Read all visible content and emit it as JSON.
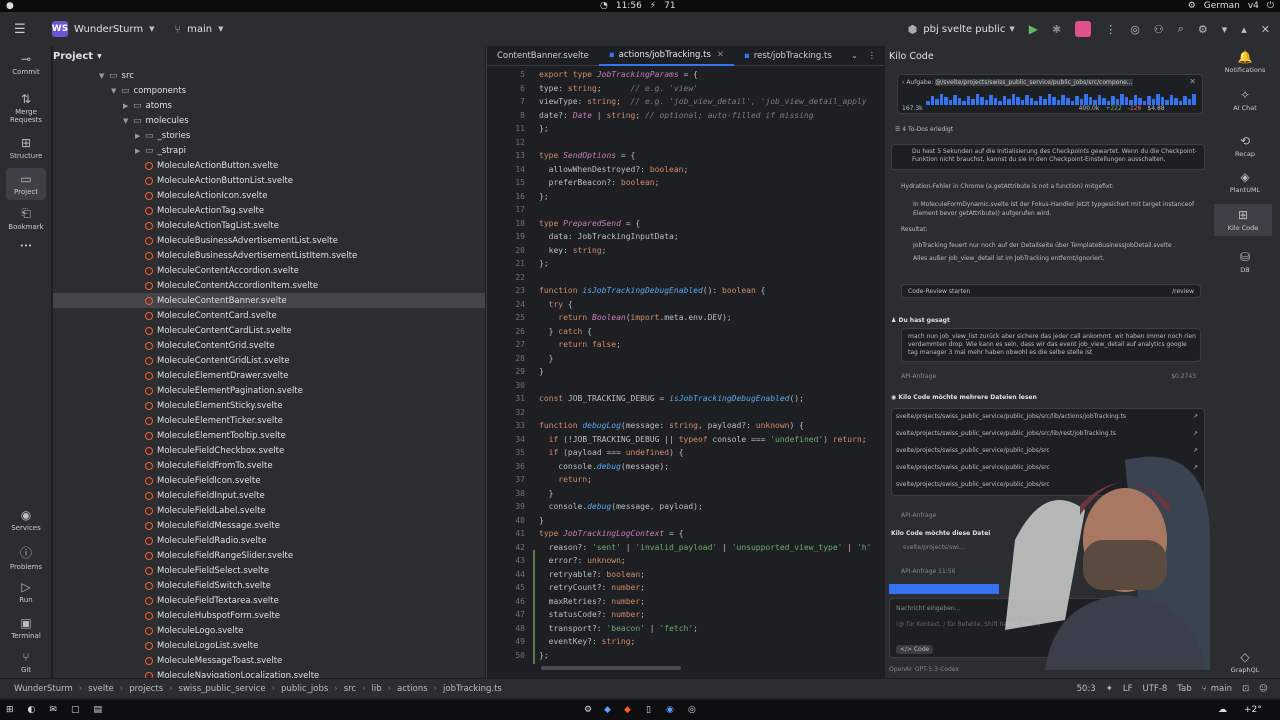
{
  "system_bar": {
    "time": "11:56",
    "battery": "71",
    "lang": "German",
    "volume": "v4"
  },
  "titlebar": {
    "project_badge": "WS",
    "project": "WunderSturm",
    "branch": "main",
    "run_config": "pbj svelte public"
  },
  "left_strip": [
    "Commit",
    "Merge Requests",
    "Structure",
    "Project",
    "Bookmark"
  ],
  "left_strip_bottom": [
    "Services",
    "Problems",
    "Run",
    "Terminal",
    "Git"
  ],
  "project_panel": {
    "title": "Project",
    "tree": [
      {
        "label": "src",
        "depth": 4,
        "type": "folder"
      },
      {
        "label": "components",
        "depth": 5,
        "type": "folder"
      },
      {
        "label": "atoms",
        "depth": 6,
        "type": "folder"
      },
      {
        "label": "molecules",
        "depth": 6,
        "type": "folder"
      },
      {
        "label": "_stories",
        "depth": 7,
        "type": "folder"
      },
      {
        "label": "_strapi",
        "depth": 7,
        "type": "folder"
      },
      {
        "label": "MoleculeActionButton.svelte",
        "depth": 7,
        "type": "file"
      },
      {
        "label": "MoleculeActionButtonList.svelte",
        "depth": 7,
        "type": "file"
      },
      {
        "label": "MoleculeActionIcon.svelte",
        "depth": 7,
        "type": "file"
      },
      {
        "label": "MoleculeActionTag.svelte",
        "depth": 7,
        "type": "file"
      },
      {
        "label": "MoleculeActionTagList.svelte",
        "depth": 7,
        "type": "file"
      },
      {
        "label": "MoleculeBusinessAdvertisementList.svelte",
        "depth": 7,
        "type": "file"
      },
      {
        "label": "MoleculeBusinessAdvertisementListItem.svelte",
        "depth": 7,
        "type": "file"
      },
      {
        "label": "MoleculeContentAccordion.svelte",
        "depth": 7,
        "type": "file"
      },
      {
        "label": "MoleculeContentAccordionItem.svelte",
        "depth": 7,
        "type": "file"
      },
      {
        "label": "MoleculeContentBanner.svelte",
        "depth": 7,
        "type": "file",
        "selected": true
      },
      {
        "label": "MoleculeContentCard.svelte",
        "depth": 7,
        "type": "file"
      },
      {
        "label": "MoleculeContentCardList.svelte",
        "depth": 7,
        "type": "file"
      },
      {
        "label": "MoleculeContentGrid.svelte",
        "depth": 7,
        "type": "file"
      },
      {
        "label": "MoleculeContentGridList.svelte",
        "depth": 7,
        "type": "file"
      },
      {
        "label": "MoleculeElementDrawer.svelte",
        "depth": 7,
        "type": "file"
      },
      {
        "label": "MoleculeElementPagination.svelte",
        "depth": 7,
        "type": "file"
      },
      {
        "label": "MoleculeElementSticky.svelte",
        "depth": 7,
        "type": "file"
      },
      {
        "label": "MoleculeElementTicker.svelte",
        "depth": 7,
        "type": "file"
      },
      {
        "label": "MoleculeElementTooltip.svelte",
        "depth": 7,
        "type": "file"
      },
      {
        "label": "MoleculeFieldCheckbox.svelte",
        "depth": 7,
        "type": "file"
      },
      {
        "label": "MoleculeFieldFromTo.svelte",
        "depth": 7,
        "type": "file"
      },
      {
        "label": "MoleculeFieldIcon.svelte",
        "depth": 7,
        "type": "file"
      },
      {
        "label": "MoleculeFieldInput.svelte",
        "depth": 7,
        "type": "file"
      },
      {
        "label": "MoleculeFieldLabel.svelte",
        "depth": 7,
        "type": "file"
      },
      {
        "label": "MoleculeFieldMessage.svelte",
        "depth": 7,
        "type": "file"
      },
      {
        "label": "MoleculeFieldRadio.svelte",
        "depth": 7,
        "type": "file"
      },
      {
        "label": "MoleculeFieldRangeSlider.svelte",
        "depth": 7,
        "type": "file"
      },
      {
        "label": "MoleculeFieldSelect.svelte",
        "depth": 7,
        "type": "file"
      },
      {
        "label": "MoleculeFieldSwitch.svelte",
        "depth": 7,
        "type": "file"
      },
      {
        "label": "MoleculeFieldTextarea.svelte",
        "depth": 7,
        "type": "file"
      },
      {
        "label": "MoleculeHubspotForm.svelte",
        "depth": 7,
        "type": "file"
      },
      {
        "label": "MoleculeLogo.svelte",
        "depth": 7,
        "type": "file"
      },
      {
        "label": "MoleculeLogoList.svelte",
        "depth": 7,
        "type": "file"
      },
      {
        "label": "MoleculeMessageToast.svelte",
        "depth": 7,
        "type": "file"
      },
      {
        "label": "MoleculeNavigationLocalization.svelte",
        "depth": 7,
        "type": "file"
      }
    ]
  },
  "editor": {
    "tabs": [
      {
        "label": "ContentBanner.svelte",
        "active": false
      },
      {
        "label": "actions/jobTracking.ts",
        "active": true
      },
      {
        "label": "rest/jobTracking.ts",
        "active": false
      }
    ],
    "lines": [
      {
        "n": "5",
        "html": "<span class='kw'>export type</span> <span class='ty'>JobTrackingParams</span> = {"
      },
      {
        "n": "6",
        "html": "type: <span class='kw'>string</span>;      <span class='cm'>// e.g. 'view'</span>"
      },
      {
        "n": "7",
        "html": "viewType: <span class='kw'>string</span>;  <span class='cm'>// e.g. 'job_view_detail', 'job_view_detail_apply</span>"
      },
      {
        "n": "8",
        "html": "date?: <span class='ty'>Date</span> | <span class='kw'>string</span>; <span class='cm'>// optional; auto-filled if missing</span>"
      },
      {
        "n": "11",
        "html": "};"
      },
      {
        "n": "12",
        "html": ""
      },
      {
        "n": "13",
        "html": "<span class='kw'>type</span> <span class='ty'>SendOptions</span> = {"
      },
      {
        "n": "14",
        "html": "  allowWhenDestroyed?: <span class='kw'>boolean</span>;"
      },
      {
        "n": "15",
        "html": "  preferBeacon?: <span class='kw'>boolean</span>;"
      },
      {
        "n": "16",
        "html": "};"
      },
      {
        "n": "17",
        "html": ""
      },
      {
        "n": "18",
        "html": "<span class='kw'>type</span> <span class='ty'>PreparedSend</span> = {"
      },
      {
        "n": "19",
        "html": "  data: JobTrackingInputData;"
      },
      {
        "n": "20",
        "html": "  key: <span class='kw'>string</span>;"
      },
      {
        "n": "21",
        "html": "};"
      },
      {
        "n": "22",
        "html": ""
      },
      {
        "n": "23",
        "html": "<span class='kw'>function</span> <span class='fn'>isJobTrackingDebugEnabled</span>(): <span class='kw'>boolean</span> {"
      },
      {
        "n": "24",
        "html": "  <span class='kw'>try</span> {"
      },
      {
        "n": "25",
        "html": "    <span class='kw'>return</span> <span class='ty'>Boolean</span>(<span class='kw'>import</span>.meta.env.DEV);"
      },
      {
        "n": "26",
        "html": "  } <span class='kw'>catch</span> {"
      },
      {
        "n": "27",
        "html": "    <span class='kw'>return false</span>;"
      },
      {
        "n": "28",
        "html": "  }"
      },
      {
        "n": "29",
        "html": "}"
      },
      {
        "n": "30",
        "html": ""
      },
      {
        "n": "31",
        "html": "<span class='kw'>const</span> JOB_TRACKING_DEBUG = <span class='fn'>isJobTrackingDebugEnabled</span>();"
      },
      {
        "n": "32",
        "html": ""
      },
      {
        "n": "33",
        "html": "<span class='kw'>function</span> <span class='fn'>debugLog</span>(message: <span class='kw'>string</span>, payload?: <span class='kw'>unknown</span>) {"
      },
      {
        "n": "34",
        "html": "  <span class='kw'>if</span> (!JOB_TRACKING_DEBUG || <span class='kw'>typeof</span> console === <span class='st'>'undefined'</span>) <span class='kw'>return</span>;"
      },
      {
        "n": "35",
        "html": "  <span class='kw'>if</span> (payload === <span class='kw'>undefined</span>) {"
      },
      {
        "n": "36",
        "html": "    console.<span class='fn'>debug</span>(message);"
      },
      {
        "n": "37",
        "html": "    <span class='kw'>return</span>;"
      },
      {
        "n": "38",
        "html": "  }"
      },
      {
        "n": "39",
        "html": "  console.<span class='fn'>debug</span>(message, payload);"
      },
      {
        "n": "40",
        "html": "}"
      },
      {
        "n": "41",
        "html": "<span class='kw'>type</span> <span class='ty'>JobTrackingLogContext</span> = {"
      },
      {
        "n": "42",
        "html": "  reason?: <span class='st'>'sent'</span> | <span class='st'>'invalid_payload'</span> | <span class='st'>'unsupported_view_type'</span> | <span class='st'>'h'</span>"
      },
      {
        "n": "43",
        "html": "  error?: <span class='kw'>unknown</span>;"
      },
      {
        "n": "44",
        "html": "  retryable?: <span class='kw'>boolean</span>;"
      },
      {
        "n": "45",
        "html": "  retryCount?: <span class='kw'>number</span>;"
      },
      {
        "n": "46",
        "html": "  maxRetries?: <span class='kw'>number</span>;"
      },
      {
        "n": "47",
        "html": "  statusCode?: <span class='kw'>number</span>;"
      },
      {
        "n": "48",
        "html": "  transport?: <span class='st'>'beacon'</span> | <span class='st'>'fetch'</span>;"
      },
      {
        "n": "49",
        "html": "  eventKey?: <span class='kw'>string</span>;"
      },
      {
        "n": "50",
        "html": "};"
      },
      {
        "n": "51",
        "html": ""
      }
    ]
  },
  "kilo": {
    "title": "Kilo Code",
    "task_label": "Aufgabe:",
    "task_path": "@/svelte/projects/swiss_public_service/public_jobs/src/compone...",
    "task_stats": [
      "167.3k",
      "400.0k",
      "+222",
      "-126",
      "$4.88"
    ],
    "todos": "4 To-Dos erledigt",
    "wait_msg": "Du hast 5 Sekunden auf die Initialisierung des Checkpoints gewartet. Wenn du die Checkpoint-Funktion nicht brauchst, kannst du sie in den Checkpoint-Einstellungen ausschalten.",
    "hydration": "Hydration-Fehler in Chrome (a.getAttribute is not a function) mitgefixt:",
    "bullet1": "In MoleculeFormDynamic.svelte ist der Fokus-Handler jetzt typgesichert mit target instanceof Element bevor getAttribute() aufgerufen wird.",
    "result_label": "Resultat:",
    "bullet2": "JobTracking feuert nur noch auf der Detailseite über TemplateBusinessJobDetail.svelte .",
    "bullet3": "Alles außer job_view_detail ist im JobTracking entfernt/ignoriert.",
    "review_btn": "Code-Review starten",
    "review_tag": "/review",
    "user_label": "Du hast gesagt",
    "user_msg": "mach nun job_view_list zurück aber sichere das jeder call ankommt. wir haben immer noch rien verdammten drop. Wie kann es sein, dass wir das event job_view_detail auf analytics google tag manager 3 mal mehr haben obwohl es die selbe stelle ist",
    "api1": "API-Anfrage",
    "api1_cost": "$0.2743",
    "read_label": "Kilo Code möchte mehrere Dateien lesen",
    "files": [
      "svelte/projects/swiss_public_service/public_jobs/src/lib/actions/jobTracking.ts",
      "svelte/projects/swiss_public_service/public_jobs/src/lib/rest/jobTracking.ts",
      "svelte/projects/swiss_public_service/public_jobs/src",
      "svelte/projects/swiss_public_service/public_jobs/src",
      "svelte/projects/swiss_public_service/public_jobs/src"
    ],
    "api2": "API-Anfrage",
    "read2": "Kilo Code möchte diese Datei",
    "read2_file": "svelte/projects/swi...",
    "api3": "API-Anfrage",
    "api3_time": "11:56",
    "input_placeholder": "Nachricht eingeben...",
    "input_hint": "(@ für Kontext, / für Befehle, Shift halten, um...)",
    "mode": "Code",
    "model": "OpenAI: GPT-5.3-Codex"
  },
  "right_strip": [
    "Notifications",
    "AI Chat",
    "Recap",
    "PlantUML",
    "Kilo Code",
    "DB",
    "GraphQL"
  ],
  "statusbar": {
    "crumbs": [
      "WunderSturm",
      "svelte",
      "projects",
      "swiss_public_service",
      "public_jobs",
      "src",
      "lib",
      "actions",
      "jobTracking.ts"
    ],
    "position": "50:3",
    "eol": "LF",
    "encoding": "UTF-8",
    "indent": "Tab",
    "branch": "main"
  },
  "taskbar": {
    "weather": "+2°"
  }
}
